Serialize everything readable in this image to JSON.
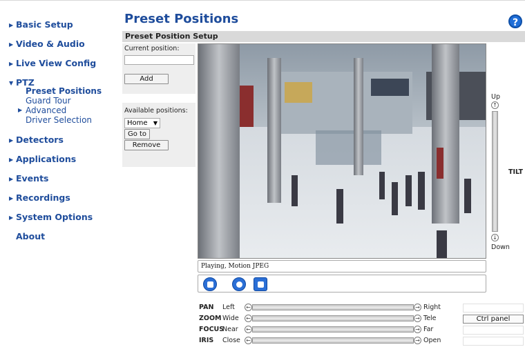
{
  "nav": {
    "basic_setup": "Basic Setup",
    "video_audio": "Video & Audio",
    "live_view": "Live View Config",
    "ptz": "PTZ",
    "ptz_items": [
      "Preset Positions",
      "Guard Tour",
      "Advanced",
      "Driver Selection"
    ],
    "detectors": "Detectors",
    "applications": "Applications",
    "events": "Events",
    "recordings": "Recordings",
    "system_options": "System Options",
    "about": "About"
  },
  "page": {
    "title": "Preset Positions",
    "help": "?",
    "section_title": "Preset Position Setup"
  },
  "left_panel": {
    "current_label": "Current position:",
    "current_value": "",
    "add_label": "Add",
    "available_label": "Available positions:",
    "selected_position": "Home",
    "goto_label": "Go to",
    "remove_label": "Remove"
  },
  "video": {
    "status_text": "Playing, Motion JPEG"
  },
  "tilt": {
    "up": "Up",
    "down": "Down",
    "label": "TILT"
  },
  "sliders": [
    {
      "name": "PAN",
      "left": "Left",
      "right": "Right"
    },
    {
      "name": "ZOOM",
      "left": "Wide",
      "right": "Tele"
    },
    {
      "name": "FOCUS",
      "left": "Near",
      "right": "Far"
    },
    {
      "name": "IRIS",
      "left": "Close",
      "right": "Open"
    }
  ],
  "ctrl_panel_label": "Ctrl panel",
  "colors": {
    "link": "#1f4d9c",
    "panel": "#eeeeee",
    "header_bar": "#d9d9d9",
    "control_blue": "#2b6fd6"
  }
}
